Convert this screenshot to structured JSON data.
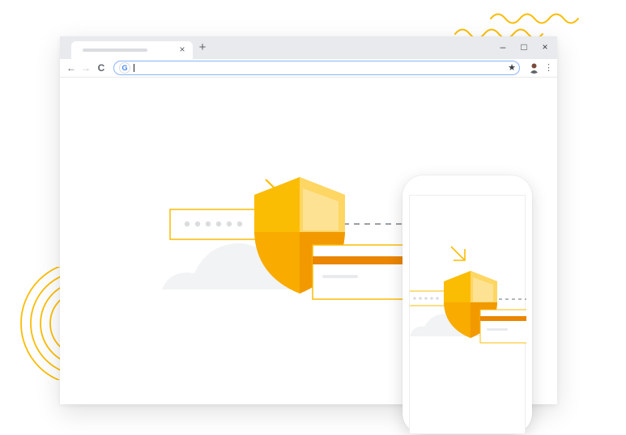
{
  "browser": {
    "tab_close": "×",
    "new_tab": "+",
    "window_controls": {
      "minimize": "–",
      "maximize": "□",
      "close": "×"
    },
    "nav": {
      "back": "←",
      "forward": "→",
      "reload": "C"
    },
    "omnibox": {
      "logo": "G"
    },
    "bookmark": "★",
    "menu": "⋮"
  },
  "colors": {
    "shield_main": "#fbbc04",
    "shield_light": "#fde293",
    "shield_dark": "#f29900",
    "accent_orange": "#ea8600",
    "cloud": "#f1f3f4",
    "dash": "#9aa0a6",
    "tab_strip": "#e8eaed"
  },
  "icons": {
    "arrow": "arrow-down-right-icon",
    "shield": "shield-icon",
    "cloud": "cloud-icon",
    "password": "password-dots-icon",
    "card": "credential-card-icon",
    "wave": "wave-decoration-icon",
    "rings": "ring-decoration-icon"
  }
}
